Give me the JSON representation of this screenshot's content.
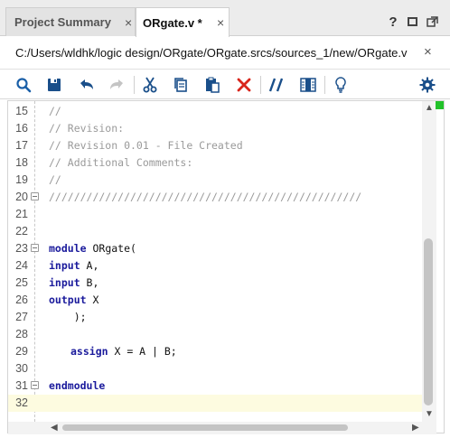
{
  "tabs": {
    "project_summary": "Project Summary",
    "orgate": "ORgate.v *",
    "close_glyph": "×"
  },
  "window": {
    "help": "?"
  },
  "path": {
    "text": "C:/Users/wldhk/logic design/ORgate/ORgate.srcs/sources_1/new/ORgate.v",
    "close_glyph": "×"
  },
  "toolbar": {
    "icons": [
      "search-icon",
      "save-icon",
      "undo-icon",
      "redo-icon",
      "cut-icon",
      "copy-icon",
      "paste-icon",
      "delete-icon",
      "comment-toggle-icon",
      "block-select-icon",
      "lightbulb-icon",
      "gear-icon"
    ],
    "accent": "#1a5fa8",
    "delete_color": "#d9261c"
  },
  "editor": {
    "lines": [
      {
        "n": "15",
        "text": "//"
      },
      {
        "n": "16",
        "text": "// Revision:"
      },
      {
        "n": "17",
        "text": "// Revision 0.01 - File Created"
      },
      {
        "n": "18",
        "text": "// Additional Comments:"
      },
      {
        "n": "19",
        "text": "//"
      },
      {
        "n": "20",
        "text": "//////////////////////////////////////////////////"
      },
      {
        "n": "21",
        "text": ""
      },
      {
        "n": "22",
        "text": ""
      },
      {
        "n": "23",
        "kw": "module",
        "text": " ORgate("
      },
      {
        "n": "24",
        "kw": "input",
        "text": " A,"
      },
      {
        "n": "25",
        "kw": "input",
        "text": " B,"
      },
      {
        "n": "26",
        "kw": "output",
        "text": " X"
      },
      {
        "n": "27",
        "text": "    );"
      },
      {
        "n": "28",
        "text": ""
      },
      {
        "n": "29",
        "kw": "assign",
        "text": " X = A | B;"
      },
      {
        "n": "30",
        "text": ""
      },
      {
        "n": "31",
        "kw": "endmodule",
        "text": ""
      },
      {
        "n": "32",
        "text": ""
      }
    ],
    "keyword_color": "#1a1a9c",
    "comment_color": "#9a9a9a",
    "current_line_color": "#fdfbe0"
  },
  "scroll": {
    "up": "▲",
    "down": "▼",
    "left": "◀",
    "right": "▶"
  }
}
